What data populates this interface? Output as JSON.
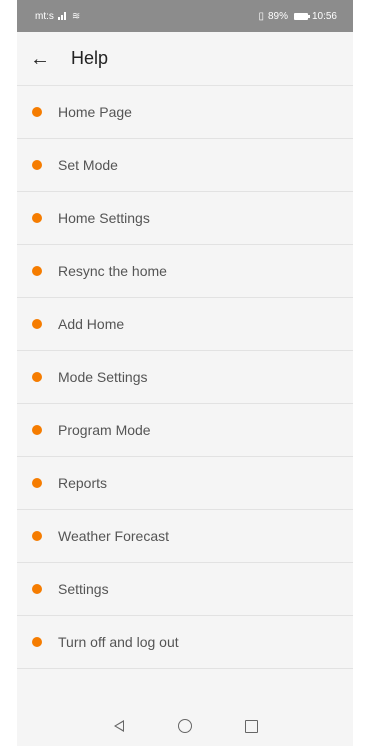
{
  "status_bar": {
    "carrier": "mt:s",
    "battery_percent": "89%",
    "time": "10:56"
  },
  "header": {
    "title": "Help"
  },
  "help_items": [
    {
      "label": "Home Page"
    },
    {
      "label": "Set Mode"
    },
    {
      "label": "Home Settings"
    },
    {
      "label": "Resync the home"
    },
    {
      "label": "Add Home"
    },
    {
      "label": "Mode Settings"
    },
    {
      "label": "Program Mode"
    },
    {
      "label": "Reports"
    },
    {
      "label": "Weather Forecast"
    },
    {
      "label": "Settings"
    },
    {
      "label": "Turn off and log out"
    }
  ],
  "colors": {
    "accent": "#f57c00",
    "status_bar": "#8c8c8c"
  },
  "icons": {
    "back": "arrow-left-icon",
    "bullet": "orange-dot-icon"
  }
}
